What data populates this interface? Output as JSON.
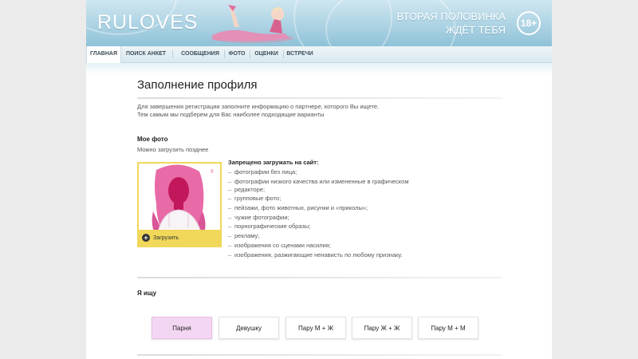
{
  "header": {
    "logo": "RULOVES",
    "tagline_line1": "ВТОРАЯ ПОЛОВИНКА",
    "tagline_line2": "ЖДЁТ ТЕБЯ",
    "age_badge": "18+"
  },
  "nav": {
    "items": [
      {
        "label": "ГЛАВНАЯ",
        "active": true
      },
      {
        "label": "ПОИСК АНКЕТ",
        "active": false
      },
      {
        "label": "СООБЩЕНИЯ",
        "active": false
      },
      {
        "label": "ФОТО",
        "active": false
      },
      {
        "label": "ОЦЕНКИ",
        "active": false
      },
      {
        "label": "ВСТРЕЧИ",
        "active": false
      }
    ]
  },
  "main": {
    "title": "Заполнение профиля",
    "intro_line1": "Для завершения регистрации заполните информацию о партнере, которого Вы ищете.",
    "intro_line2": "Тем самым мы подберем для Вас наиболее подходящие варианты"
  },
  "photo": {
    "heading": "Мое фото",
    "note": "Можно загрузить позднее",
    "upload_label": "Загрузить",
    "forbidden_title": "Запрещено загружать на сайт:",
    "forbidden_items": [
      "фотографии без лица;",
      "фотографии низкого качества или измененные в графическом",
      "редакторе;",
      "групповые фото;",
      "пейзажи, фото животных, рисунки и «приколы»;",
      "чужие фотографии;",
      "порнографические образы;",
      "рекламу;",
      "изображения со сценами насилия;",
      "изображения, разжигающие ненависть по любому признаку."
    ]
  },
  "seeking": {
    "heading": "Я ищу",
    "options": [
      {
        "label": "Парня",
        "selected": true
      },
      {
        "label": "Девушку",
        "selected": false
      },
      {
        "label": "Пару М + Ж",
        "selected": false
      },
      {
        "label": "Пару Ж + Ж",
        "selected": false
      },
      {
        "label": "Пару М + М",
        "selected": false
      }
    ]
  },
  "colors": {
    "accent_pink": "#e0559b",
    "upload_yellow": "#f1d75a",
    "selected_option": "#f3d7f2",
    "header_blue": "#a9d1e2"
  }
}
